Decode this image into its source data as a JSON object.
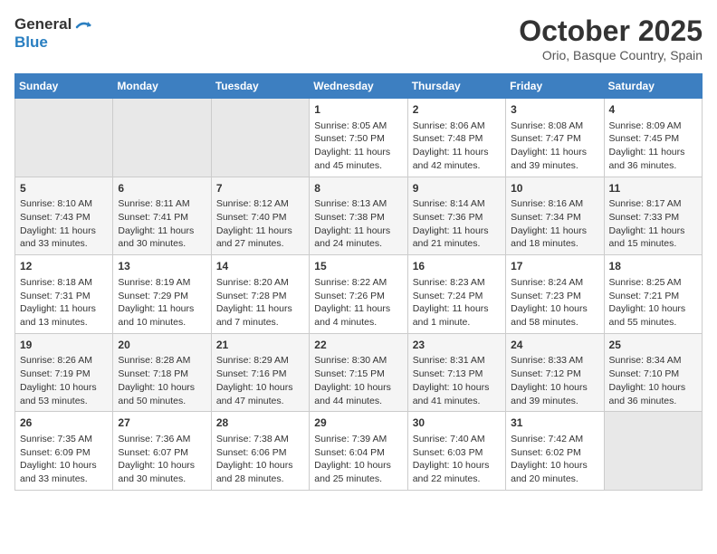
{
  "logo": {
    "general": "General",
    "blue": "Blue"
  },
  "title": "October 2025",
  "location": "Orio, Basque Country, Spain",
  "days_of_week": [
    "Sunday",
    "Monday",
    "Tuesday",
    "Wednesday",
    "Thursday",
    "Friday",
    "Saturday"
  ],
  "weeks": [
    [
      {
        "day": "",
        "sunrise": "",
        "sunset": "",
        "daylight": "",
        "empty": true
      },
      {
        "day": "",
        "sunrise": "",
        "sunset": "",
        "daylight": "",
        "empty": true
      },
      {
        "day": "",
        "sunrise": "",
        "sunset": "",
        "daylight": "",
        "empty": true
      },
      {
        "day": "1",
        "sunrise": "Sunrise: 8:05 AM",
        "sunset": "Sunset: 7:50 PM",
        "daylight": "Daylight: 11 hours and 45 minutes."
      },
      {
        "day": "2",
        "sunrise": "Sunrise: 8:06 AM",
        "sunset": "Sunset: 7:48 PM",
        "daylight": "Daylight: 11 hours and 42 minutes."
      },
      {
        "day": "3",
        "sunrise": "Sunrise: 8:08 AM",
        "sunset": "Sunset: 7:47 PM",
        "daylight": "Daylight: 11 hours and 39 minutes."
      },
      {
        "day": "4",
        "sunrise": "Sunrise: 8:09 AM",
        "sunset": "Sunset: 7:45 PM",
        "daylight": "Daylight: 11 hours and 36 minutes."
      }
    ],
    [
      {
        "day": "5",
        "sunrise": "Sunrise: 8:10 AM",
        "sunset": "Sunset: 7:43 PM",
        "daylight": "Daylight: 11 hours and 33 minutes."
      },
      {
        "day": "6",
        "sunrise": "Sunrise: 8:11 AM",
        "sunset": "Sunset: 7:41 PM",
        "daylight": "Daylight: 11 hours and 30 minutes."
      },
      {
        "day": "7",
        "sunrise": "Sunrise: 8:12 AM",
        "sunset": "Sunset: 7:40 PM",
        "daylight": "Daylight: 11 hours and 27 minutes."
      },
      {
        "day": "8",
        "sunrise": "Sunrise: 8:13 AM",
        "sunset": "Sunset: 7:38 PM",
        "daylight": "Daylight: 11 hours and 24 minutes."
      },
      {
        "day": "9",
        "sunrise": "Sunrise: 8:14 AM",
        "sunset": "Sunset: 7:36 PM",
        "daylight": "Daylight: 11 hours and 21 minutes."
      },
      {
        "day": "10",
        "sunrise": "Sunrise: 8:16 AM",
        "sunset": "Sunset: 7:34 PM",
        "daylight": "Daylight: 11 hours and 18 minutes."
      },
      {
        "day": "11",
        "sunrise": "Sunrise: 8:17 AM",
        "sunset": "Sunset: 7:33 PM",
        "daylight": "Daylight: 11 hours and 15 minutes."
      }
    ],
    [
      {
        "day": "12",
        "sunrise": "Sunrise: 8:18 AM",
        "sunset": "Sunset: 7:31 PM",
        "daylight": "Daylight: 11 hours and 13 minutes."
      },
      {
        "day": "13",
        "sunrise": "Sunrise: 8:19 AM",
        "sunset": "Sunset: 7:29 PM",
        "daylight": "Daylight: 11 hours and 10 minutes."
      },
      {
        "day": "14",
        "sunrise": "Sunrise: 8:20 AM",
        "sunset": "Sunset: 7:28 PM",
        "daylight": "Daylight: 11 hours and 7 minutes."
      },
      {
        "day": "15",
        "sunrise": "Sunrise: 8:22 AM",
        "sunset": "Sunset: 7:26 PM",
        "daylight": "Daylight: 11 hours and 4 minutes."
      },
      {
        "day": "16",
        "sunrise": "Sunrise: 8:23 AM",
        "sunset": "Sunset: 7:24 PM",
        "daylight": "Daylight: 11 hours and 1 minute."
      },
      {
        "day": "17",
        "sunrise": "Sunrise: 8:24 AM",
        "sunset": "Sunset: 7:23 PM",
        "daylight": "Daylight: 10 hours and 58 minutes."
      },
      {
        "day": "18",
        "sunrise": "Sunrise: 8:25 AM",
        "sunset": "Sunset: 7:21 PM",
        "daylight": "Daylight: 10 hours and 55 minutes."
      }
    ],
    [
      {
        "day": "19",
        "sunrise": "Sunrise: 8:26 AM",
        "sunset": "Sunset: 7:19 PM",
        "daylight": "Daylight: 10 hours and 53 minutes."
      },
      {
        "day": "20",
        "sunrise": "Sunrise: 8:28 AM",
        "sunset": "Sunset: 7:18 PM",
        "daylight": "Daylight: 10 hours and 50 minutes."
      },
      {
        "day": "21",
        "sunrise": "Sunrise: 8:29 AM",
        "sunset": "Sunset: 7:16 PM",
        "daylight": "Daylight: 10 hours and 47 minutes."
      },
      {
        "day": "22",
        "sunrise": "Sunrise: 8:30 AM",
        "sunset": "Sunset: 7:15 PM",
        "daylight": "Daylight: 10 hours and 44 minutes."
      },
      {
        "day": "23",
        "sunrise": "Sunrise: 8:31 AM",
        "sunset": "Sunset: 7:13 PM",
        "daylight": "Daylight: 10 hours and 41 minutes."
      },
      {
        "day": "24",
        "sunrise": "Sunrise: 8:33 AM",
        "sunset": "Sunset: 7:12 PM",
        "daylight": "Daylight: 10 hours and 39 minutes."
      },
      {
        "day": "25",
        "sunrise": "Sunrise: 8:34 AM",
        "sunset": "Sunset: 7:10 PM",
        "daylight": "Daylight: 10 hours and 36 minutes."
      }
    ],
    [
      {
        "day": "26",
        "sunrise": "Sunrise: 7:35 AM",
        "sunset": "Sunset: 6:09 PM",
        "daylight": "Daylight: 10 hours and 33 minutes."
      },
      {
        "day": "27",
        "sunrise": "Sunrise: 7:36 AM",
        "sunset": "Sunset: 6:07 PM",
        "daylight": "Daylight: 10 hours and 30 minutes."
      },
      {
        "day": "28",
        "sunrise": "Sunrise: 7:38 AM",
        "sunset": "Sunset: 6:06 PM",
        "daylight": "Daylight: 10 hours and 28 minutes."
      },
      {
        "day": "29",
        "sunrise": "Sunrise: 7:39 AM",
        "sunset": "Sunset: 6:04 PM",
        "daylight": "Daylight: 10 hours and 25 minutes."
      },
      {
        "day": "30",
        "sunrise": "Sunrise: 7:40 AM",
        "sunset": "Sunset: 6:03 PM",
        "daylight": "Daylight: 10 hours and 22 minutes."
      },
      {
        "day": "31",
        "sunrise": "Sunrise: 7:42 AM",
        "sunset": "Sunset: 6:02 PM",
        "daylight": "Daylight: 10 hours and 20 minutes."
      },
      {
        "day": "",
        "sunrise": "",
        "sunset": "",
        "daylight": "",
        "empty": true
      }
    ]
  ]
}
